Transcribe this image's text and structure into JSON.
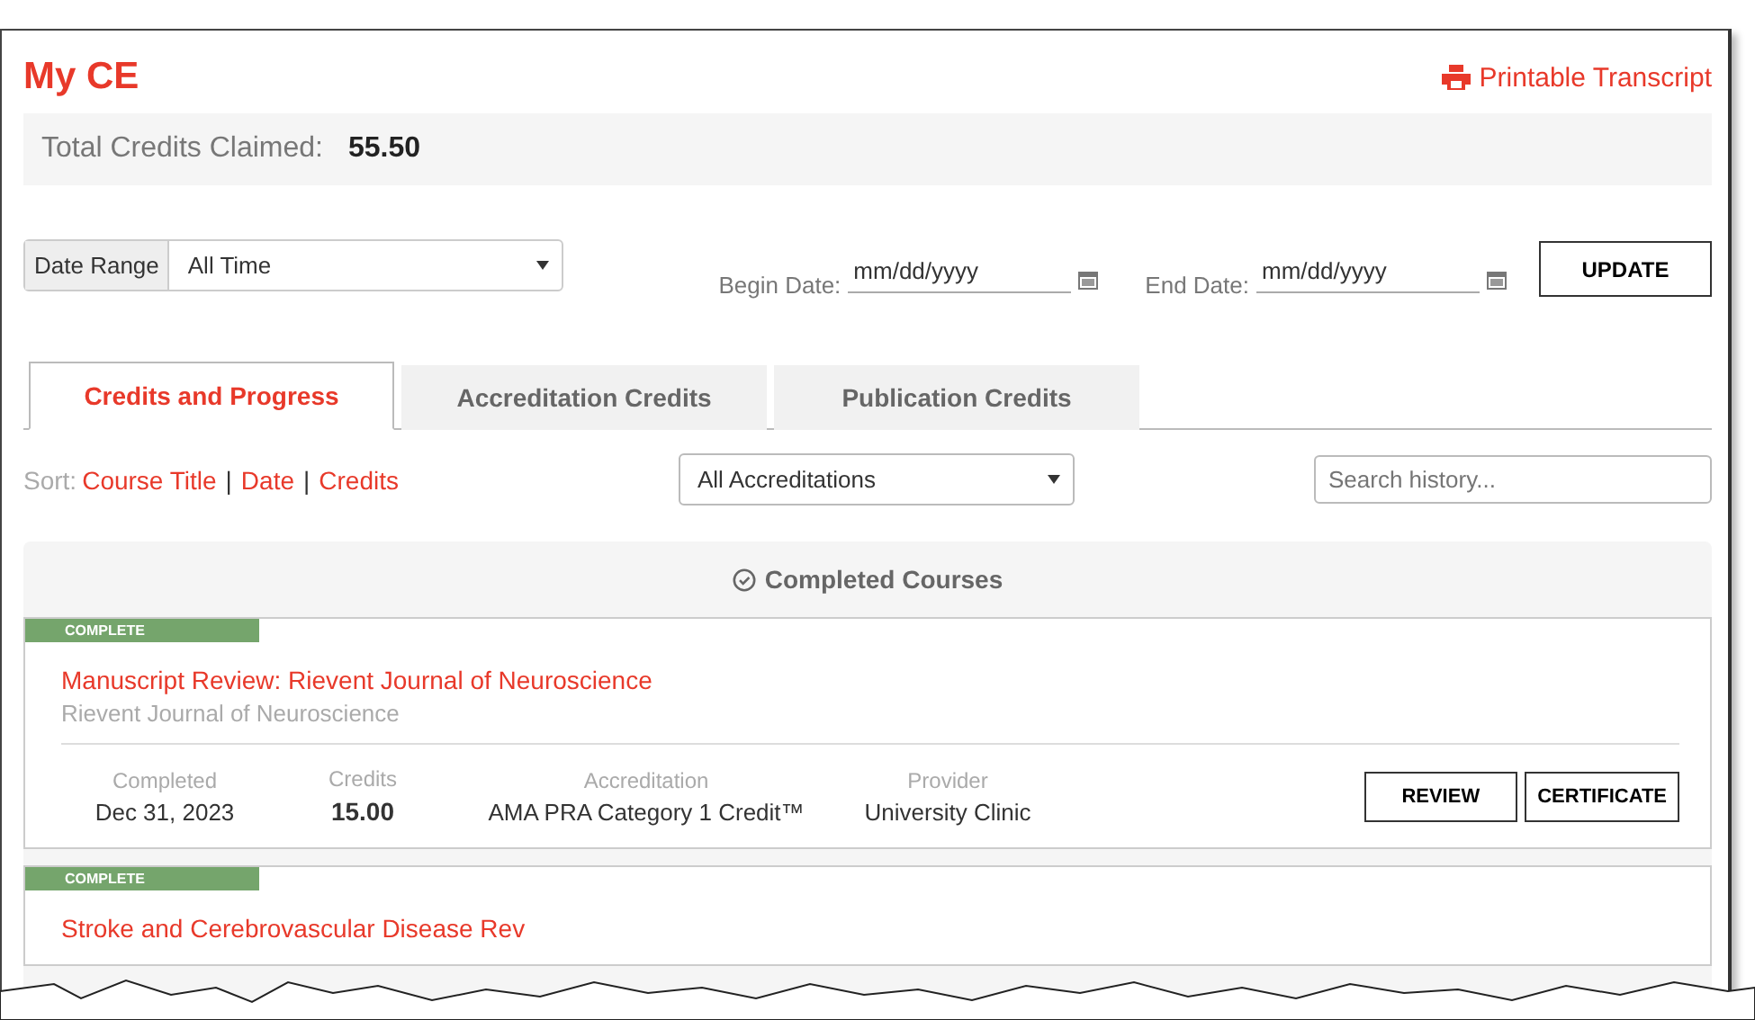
{
  "header": {
    "title": "My CE",
    "print_link": "Printable Transcript"
  },
  "summary": {
    "label": "Total Credits Claimed:",
    "value": "55.50"
  },
  "filters": {
    "range_label": "Date Range",
    "range_value": "All Time",
    "begin_label": "Begin Date:",
    "begin_placeholder": "mm/dd/yyyy",
    "end_label": "End Date:",
    "end_placeholder": "mm/dd/yyyy",
    "update_button": "UPDATE"
  },
  "tabs": [
    {
      "label": "Credits and Progress",
      "selected": true
    },
    {
      "label": "Accreditation Credits",
      "selected": false
    },
    {
      "label": "Publication Credits",
      "selected": false
    }
  ],
  "sort": {
    "label": "Sort:",
    "options": [
      "Course Title",
      "Date",
      "Credits"
    ],
    "separator": "|"
  },
  "accreditation_select": "All Accreditations",
  "search": {
    "placeholder": "Search history..."
  },
  "section_title": "Completed Courses",
  "courses": [
    {
      "status": "COMPLETE",
      "title": "Manuscript Review: Rievent Journal of Neuroscience",
      "subtitle": "Rievent Journal of Neuroscience",
      "fields": [
        {
          "label": "Completed",
          "value": "Dec 31, 2023",
          "kind": "plain"
        },
        {
          "label": "Credits",
          "value": "15.00",
          "kind": "strong"
        },
        {
          "label": "Accreditation",
          "value": "AMA PRA Category 1 Credit™",
          "kind": "plain"
        },
        {
          "label": "Provider",
          "value": "University Clinic",
          "kind": "plain"
        }
      ],
      "buttons": [
        "REVIEW",
        "CERTIFICATE"
      ]
    },
    {
      "status": "COMPLETE",
      "title": "Stroke and Cerebrovascular Disease Rev"
    }
  ]
}
